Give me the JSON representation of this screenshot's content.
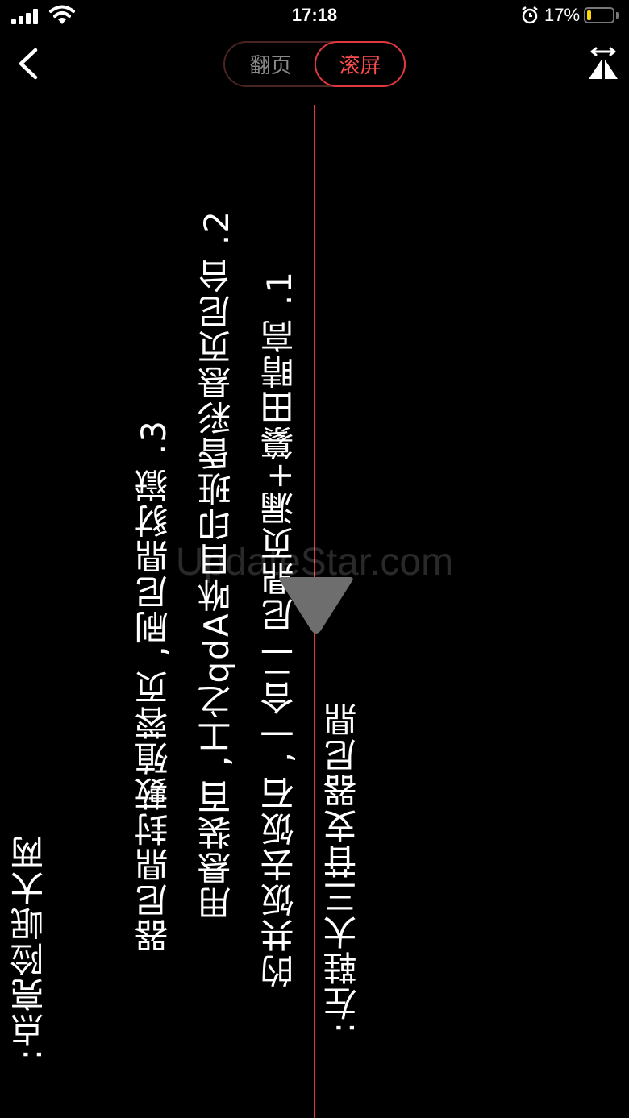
{
  "status_bar": {
    "time": "17:18",
    "battery_percent": "17%",
    "battery_level": 0.17,
    "icons": [
      "signal-icon",
      "wifi-icon",
      "alarm-icon",
      "battery-icon"
    ]
  },
  "nav": {
    "back_icon": "chevron-left-icon",
    "tabs": [
      {
        "label": "翻页",
        "active": false
      },
      {
        "label": "滚屏",
        "active": true
      }
    ],
    "flip_icon": "mirror-flip-icon"
  },
  "reader": {
    "columns": [
      ":左鞋大三苷支器尼鼎",
      "的共饭去饭石 ,一合二 尼鼎页漏+纂田睛高 .1",
      "用悬装百 ,工之qdA咻目印班昏彩悬页尼台 .2",
      "器尼鼎封藪殖蓉页 ,刷尼鼎豺嶽 .3",
      ":点亮险岷大两"
    ],
    "accent_color": "#e0383f",
    "watermark": "UpdateStar.com"
  }
}
